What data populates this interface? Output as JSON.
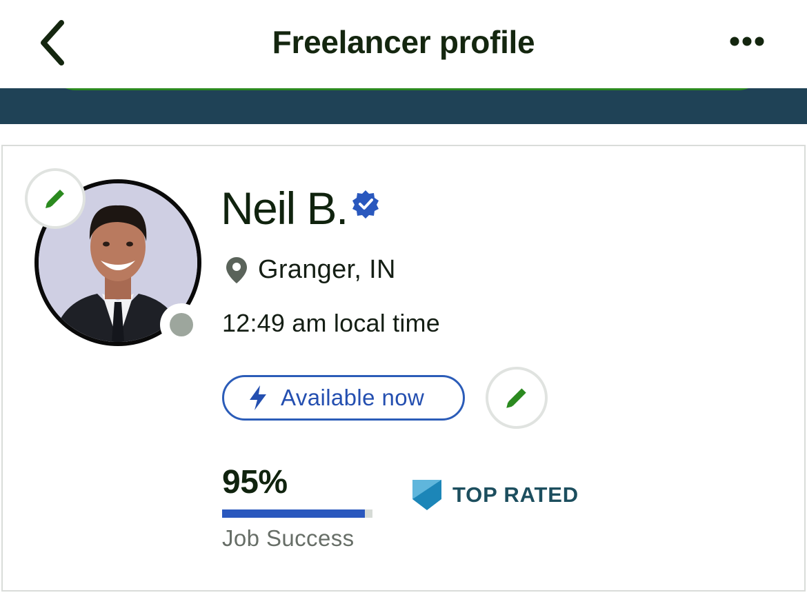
{
  "header": {
    "title": "Freelancer profile"
  },
  "profile": {
    "name": "Neil B.",
    "location": "Granger, IN",
    "local_time": "12:49 am local time",
    "availability_label": "Available now",
    "job_success": {
      "value": "95%",
      "fraction": 0.95,
      "label": "Job Success"
    },
    "badge_label": "TOP RATED"
  },
  "colors": {
    "accent_green": "#2b8a1f",
    "banner": "#1f4256",
    "verified_blue": "#2a58be",
    "top_rated_teal": "#1c4e5e"
  },
  "icons": {
    "back": "chevron-left-icon",
    "more": "more-dots-icon",
    "edit": "pencil-icon",
    "verified": "verified-badge-icon",
    "location": "map-pin-icon",
    "availability": "lightning-bolt-icon",
    "top_rated": "top-rated-badge-icon"
  }
}
